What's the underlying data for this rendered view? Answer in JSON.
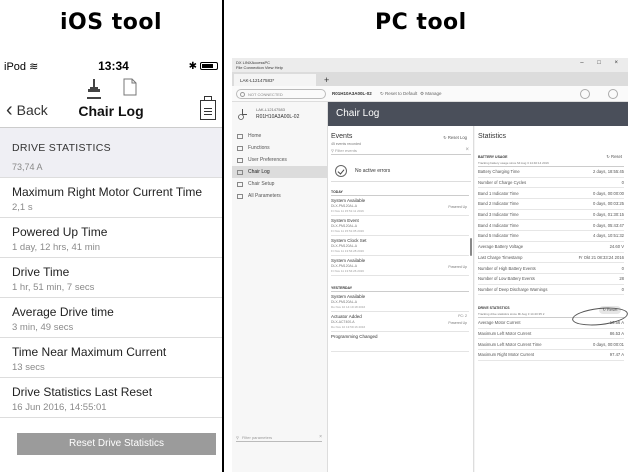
{
  "labels": {
    "ios": "iOS tool",
    "pc": "PC tool"
  },
  "ios": {
    "status": {
      "carrier": "iPod",
      "time": "13:34",
      "bt": "✱"
    },
    "nav": {
      "back": "Back",
      "title": "Chair Log"
    },
    "section": "DRIVE STATISTICS",
    "partial_value": "73,74 A",
    "rows": [
      {
        "label": "Maximum Right Motor Current Time",
        "value": "2,1 s"
      },
      {
        "label": "Powered Up Time",
        "value": "1 day, 12 hrs, 41 min"
      },
      {
        "label": "Drive Time",
        "value": "1 hr, 51 min, 7 secs"
      },
      {
        "label": "Average Drive time",
        "value": "3 min, 49 secs"
      },
      {
        "label": "Time Near Maximum Current",
        "value": "13 secs"
      },
      {
        "label": "Drive Statistics Last Reset",
        "value": "16 Jun 2016, 14:55:01"
      }
    ],
    "button": "Reset Drive Statistics"
  },
  "pc": {
    "menu": {
      "app": "DX LINXAccessPC",
      "items": "File  Connection  View  Help"
    },
    "window_controls": "– □ ×",
    "tab": "LAK-L12147583*",
    "new_tab": "+",
    "toolbar": {
      "conn": "NOT CONNECTED",
      "device": "R01H10A3A00L-02",
      "reset": "Reset to Default",
      "manage": "Manage"
    },
    "device_card": {
      "line1": "LAK-L12147583",
      "line2": "R01H10A3A00L-02"
    },
    "nav": [
      "Home",
      "Functions",
      "User Preferences",
      "Chair Log",
      "Chair Setup",
      "All Parameters"
    ],
    "filter_placeholder": "Filter parameters",
    "header": "Chair Log",
    "events": {
      "title": "Events",
      "reset": "Reset Log",
      "count": "45 events recorded",
      "filter": "Filter events",
      "no_active": "No active errors",
      "today": "TODAY",
      "yesterday": "YESTERDAY",
      "items_today": [
        {
          "name": "System Available",
          "source": "DLX-PM120AL-A",
          "time": "Fr Nov 11 15:51:11 2016",
          "right": "Powered Up"
        },
        {
          "name": "System Event",
          "source": "DLX-PM120AL-A",
          "time": "Fr Nov 11 15:51:05 2016",
          "right": ""
        },
        {
          "name": "System Clock Set",
          "source": "DLX-PM120AL-A",
          "time": "Fr Nov 11 13:54:28 2016",
          "right": ""
        },
        {
          "name": "System Available",
          "source": "DLX-PM120AL-A",
          "time": "Fr Nov 11 13:54:26 2016",
          "right": "Powered Up"
        }
      ],
      "items_yesterday": [
        {
          "name": "System Available",
          "source": "DLX-PM120AL-A",
          "time": "Do Nov 10 14:19:18 2016",
          "right": "",
          "code": ""
        },
        {
          "name": "Actuator Added",
          "source": "DLX-ACT400-A",
          "time": "Do Nov 10 13:59:16 2016",
          "right": "Powered Up",
          "code": "FC: 2"
        },
        {
          "name": "Programming Changed",
          "source": "",
          "time": "",
          "right": "",
          "code": ""
        }
      ]
    },
    "stats": {
      "title": "Statistics",
      "battery": {
        "head": "BATTERY USAGE",
        "sub": "Tracking battery usage since Mi Aug 3 14:40:14 2016",
        "reset": "Reset",
        "rows": [
          [
            "Battery Charging Time",
            "2 days, 18:55:45"
          ],
          [
            "Number of Charge Cycles",
            "0"
          ],
          [
            "Band 1 Indicator Time",
            "0 days, 00:00:00"
          ],
          [
            "Band 2 Indicator Time",
            "0 days, 00:03:25"
          ],
          [
            "Band 3 Indicator Time",
            "0 days, 01:30:15"
          ],
          [
            "Band 4 Indicator Time",
            "0 days, 05:43:47"
          ],
          [
            "Band 5 Indicator Time",
            "4 days, 10:51:32"
          ],
          [
            "Average Battery Voltage",
            "24.60 V"
          ],
          [
            "Last Charge Timestamp",
            "Fr Okt 21 08:33:24 2016"
          ],
          [
            "Number of High Battery Events",
            "0"
          ],
          [
            "Number of Low Battery Events",
            "28"
          ],
          [
            "Number of Deep Discharge Warnings",
            "0"
          ]
        ]
      },
      "drive": {
        "head": "DRIVE STATISTICS",
        "sub": "Tracking drive statistics since Mi Aug 3 14:40:35 2",
        "reset": "Reset",
        "rows": [
          [
            "Average Motor Current",
            "13.56 A"
          ],
          [
            "Maximum Left Motor Current",
            "86.53 A"
          ],
          [
            "Maximum Left Motor Current Time",
            "0 days, 00:00:01"
          ],
          [
            "Maximum Right Motor Current",
            "97.47 A"
          ]
        ]
      }
    }
  }
}
